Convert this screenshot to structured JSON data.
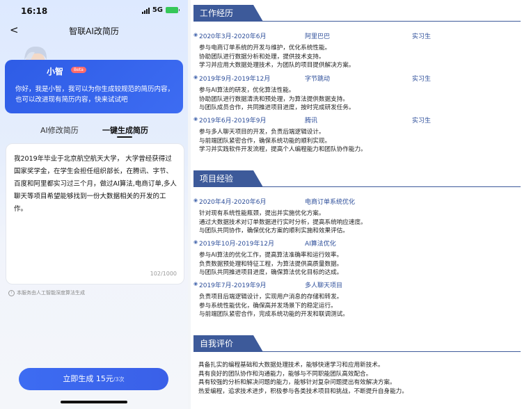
{
  "status": {
    "time": "16:18",
    "network": "5G"
  },
  "nav": {
    "back_label": "<",
    "title": "智联AI改简历"
  },
  "assistant": {
    "name": "小智",
    "badge": "Beta",
    "intro": "你好，我是小智，我可以为你生成较规范的简历内容，也可以改进现有简历内容，快来试试吧"
  },
  "tabs": [
    {
      "label": "AI修改简历",
      "active": false
    },
    {
      "label": "一键生成简历",
      "active": true
    }
  ],
  "input": {
    "value": "我2019年毕业于北京航空航天大学，  大学曾经获得过国家奖学金，在学生会担任组织部长，在腾讯、字节、百度和阿里都实习过三个月，做过AI算法,电商订单,多人聊天等项目希望能够找到一份大数据相关的开发的工作。",
    "counter": "102/1000"
  },
  "notice": "本服务由人工智能深度算法生成",
  "generate_button": {
    "label": "立即生成 15元",
    "quota": "/3次"
  },
  "resume": {
    "sections": {
      "work": "工作经历",
      "project": "项目经验",
      "self": "自我评价"
    },
    "work": [
      {
        "date": "2020年3月-2020年6月",
        "org": "阿里巴巴",
        "role": "实习生",
        "lines": [
          "参与电商订单系统的开发与维护，优化系统性能。",
          "协助团队进行数据分析和处理，提供技术支持。",
          "学习并应用大数据处理技术，为团队的项目提供解决方案。"
        ]
      },
      {
        "date": "2019年9月-2019年12月",
        "org": "字节跳动",
        "role": "实习生",
        "lines": [
          "参与AI算法的研发，优化算法性能。",
          "协助团队进行数据清洗和预处理，为算法提供数据支持。",
          "与团队成员合作，共同推进项目进度，按时完成研发任务。"
        ]
      },
      {
        "date": "2019年6月-2019年9月",
        "org": "腾讯",
        "role": "实习生",
        "lines": [
          "参与多人聊天项目的开发，负责后端逻辑设计。",
          "与前端团队紧密合作，确保系统功能的顺利实现。",
          "学习并实践软件开发流程，提高个人编程能力和团队协作能力。"
        ]
      }
    ],
    "projects": [
      {
        "date": "2020年4月-2020年6月",
        "org": "电商订单系统优化",
        "role": "",
        "lines": [
          "针对现有系统性能瓶颈，提出并实施优化方案。",
          "通过大数据技术对订单数据进行实时分析，提高系统响应速度。",
          "与团队共同协作，确保优化方案的顺利实施和效果评估。"
        ]
      },
      {
        "date": "2019年10月-2019年12月",
        "org": "AI算法优化",
        "role": "",
        "lines": [
          "参与AI算法的优化工作，提高算法准确率和运行效率。",
          "负责数据预处理和特征工程，为算法提供高质量数据。",
          "与团队共同推进项目进度，确保算法优化目标的达成。"
        ]
      },
      {
        "date": "2019年7月-2019年9月",
        "org": "多人聊天项目",
        "role": "",
        "lines": [
          "负责项目后端逻辑设计，实现用户消息的存储和转发。",
          "参与系统性能优化，确保高并发场景下的稳定运行。",
          "与前端团队紧密合作，完成系统功能的开发和联调测试。"
        ]
      }
    ],
    "self_eval": [
      "具备扎实的编程基础和大数据处理技术，能够快速学习和应用新技术。",
      "具有良好的团队协作和沟通能力，能够与不同职能团队高效配合。",
      "具有较强的分析和解决问题的能力，能够针对复杂问题提出有效解决方案。",
      "热爱编程，追求技术进步，积极参与各类技术项目和挑战，不断提升自身能力。"
    ]
  },
  "colors": {
    "primary": "#3d6cf2",
    "resume_accent": "#3d5a9a",
    "badge": "#ff6b6b"
  }
}
